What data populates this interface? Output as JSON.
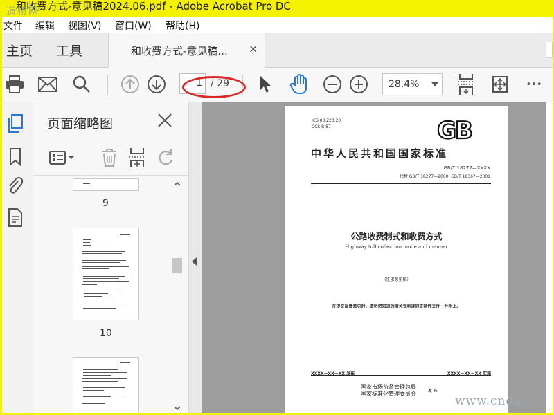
{
  "window": {
    "title": "和收费方式-意见稿2024.06.pdf - Adobe Acrobat Pro DC",
    "watermark": "道桥网"
  },
  "menu": {
    "items": [
      "文件",
      "编辑",
      "视图(V)",
      "窗口(W)",
      "帮助(H)"
    ]
  },
  "tabs": {
    "home": "主页",
    "tools": "工具",
    "document": "和收费方式-意见稿...",
    "close_glyph": "×"
  },
  "toolbar": {
    "current_page": "1",
    "total_pages": "/ 29",
    "zoom": "28.4%",
    "more_glyph": "•••"
  },
  "icons": {
    "print": "printer-icon",
    "email": "envelope-icon",
    "search": "magnifier-icon",
    "prev_page": "arrow-up-circle-icon",
    "next_page": "arrow-down-circle-icon",
    "select": "pointer-arrow-icon",
    "hand": "hand-icon",
    "zoom_out": "minus-circle-icon",
    "zoom_in": "plus-circle-icon",
    "fit_page": "fit-page-icon",
    "full_screen": "expand-icon"
  },
  "thumbnail_panel": {
    "title": "页面缩略图",
    "close_glyph": "✕",
    "pages": [
      "9",
      "10"
    ]
  },
  "document": {
    "ics": "ICS  03.220.20",
    "ccs": "CCS R 87",
    "gb_logo": "GB",
    "national_standard": "中华人民共和国国家标准",
    "standard_number": "GB/T 18277—XXXX",
    "replaces": "代替 GB/T 18277—2000, GB/T 18367—2001",
    "title_cn": "公路收费制式和收费方式",
    "title_en": "Highway toll collection mode and manner",
    "draft": "（征求意见稿）",
    "notice": "在提交反馈意见时，请将您知道的相关专利连同支持性文件一并附上。",
    "published": "XXXX－XX－XX 发布",
    "implemented": "XXXX－XX－XX 实施",
    "issuer_1": "国家市场监督管理总局",
    "issuer_2": "国家标准化管理委员会",
    "issue": "发 布"
  },
  "footer": {
    "watermark": "www.cnda"
  },
  "colors": {
    "highlight_ellipse": "#d92a2a",
    "window_border": "#f5f200",
    "hand_tool": "#2a78d4"
  }
}
